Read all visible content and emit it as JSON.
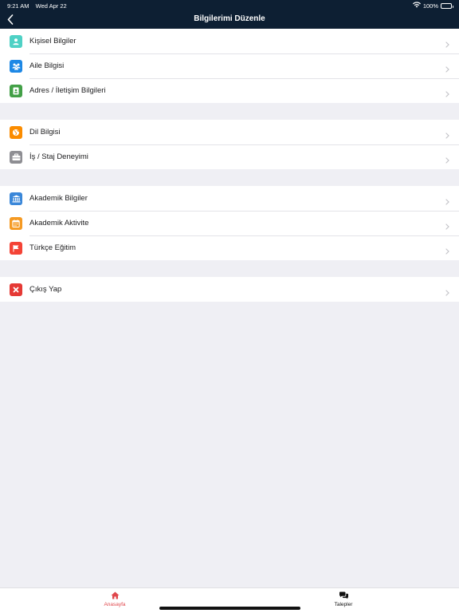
{
  "status_bar": {
    "time": "9:21 AM",
    "date": "Wed Apr 22",
    "battery": "100%"
  },
  "header": {
    "title": "Bilgilerimi Düzenle"
  },
  "groups": [
    [
      {
        "label": "Kişisel Bilgiler",
        "icon": "person-icon",
        "color": "#4fd1c5"
      },
      {
        "label": "Aile Bilgisi",
        "icon": "family-icon",
        "color": "#1e88e5"
      },
      {
        "label": "Adres / İletişim Bilgileri",
        "icon": "contact-card-icon",
        "color": "#43a047"
      }
    ],
    [
      {
        "label": "Dil Bilgisi",
        "icon": "globe-icon",
        "color": "#fb8c00"
      },
      {
        "label": "İş / Staj Deneyimi",
        "icon": "briefcase-icon",
        "color": "#8e8e93"
      }
    ],
    [
      {
        "label": "Akademik Bilgiler",
        "icon": "university-icon",
        "color": "#3a87d9"
      },
      {
        "label": "Akademik Aktivite",
        "icon": "calendar-icon",
        "color": "#f59a23"
      },
      {
        "label": "Türkçe Eğitim",
        "icon": "flag-icon",
        "color": "#f44336"
      }
    ],
    [
      {
        "label": "Çıkış Yap",
        "icon": "close-icon",
        "color": "#e53935"
      }
    ]
  ],
  "tabbar": {
    "home_label": "Anasayfa",
    "requests_label": "Talepler",
    "active_color": "#e0474c"
  }
}
